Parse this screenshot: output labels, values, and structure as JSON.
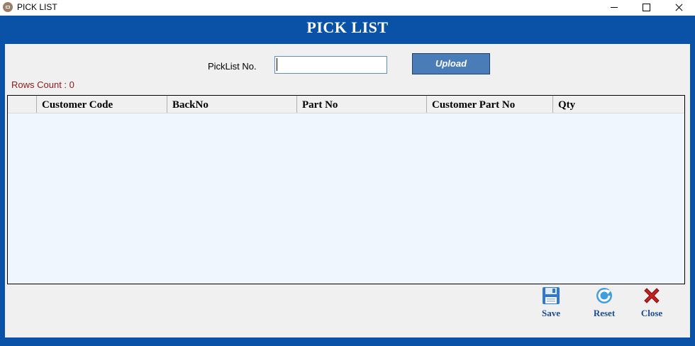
{
  "window": {
    "title": "PICK LIST"
  },
  "header": {
    "title": "PICK LIST"
  },
  "form": {
    "picklist_label": "PickList No.",
    "picklist_value": "",
    "upload_label": "Upload"
  },
  "rows_count": "Rows Count : 0",
  "grid": {
    "columns": [
      "",
      "Customer Code",
      "BackNo",
      "Part No",
      "Customer Part No",
      "Qty"
    ],
    "rows": []
  },
  "toolbar": {
    "save_label": "Save",
    "reset_label": "Reset",
    "close_label": "Close"
  },
  "icons": {
    "app": "app-icon",
    "save": "floppy-disk-icon",
    "reset": "refresh-icon",
    "close": "red-x-icon"
  },
  "colors": {
    "frame": "#0a52a8",
    "upload_button": "#4a7cb8",
    "rows_count_text": "#8b1a1a",
    "toolbar_label": "#1e4b8f",
    "grid_background": "#f0f6fd"
  }
}
